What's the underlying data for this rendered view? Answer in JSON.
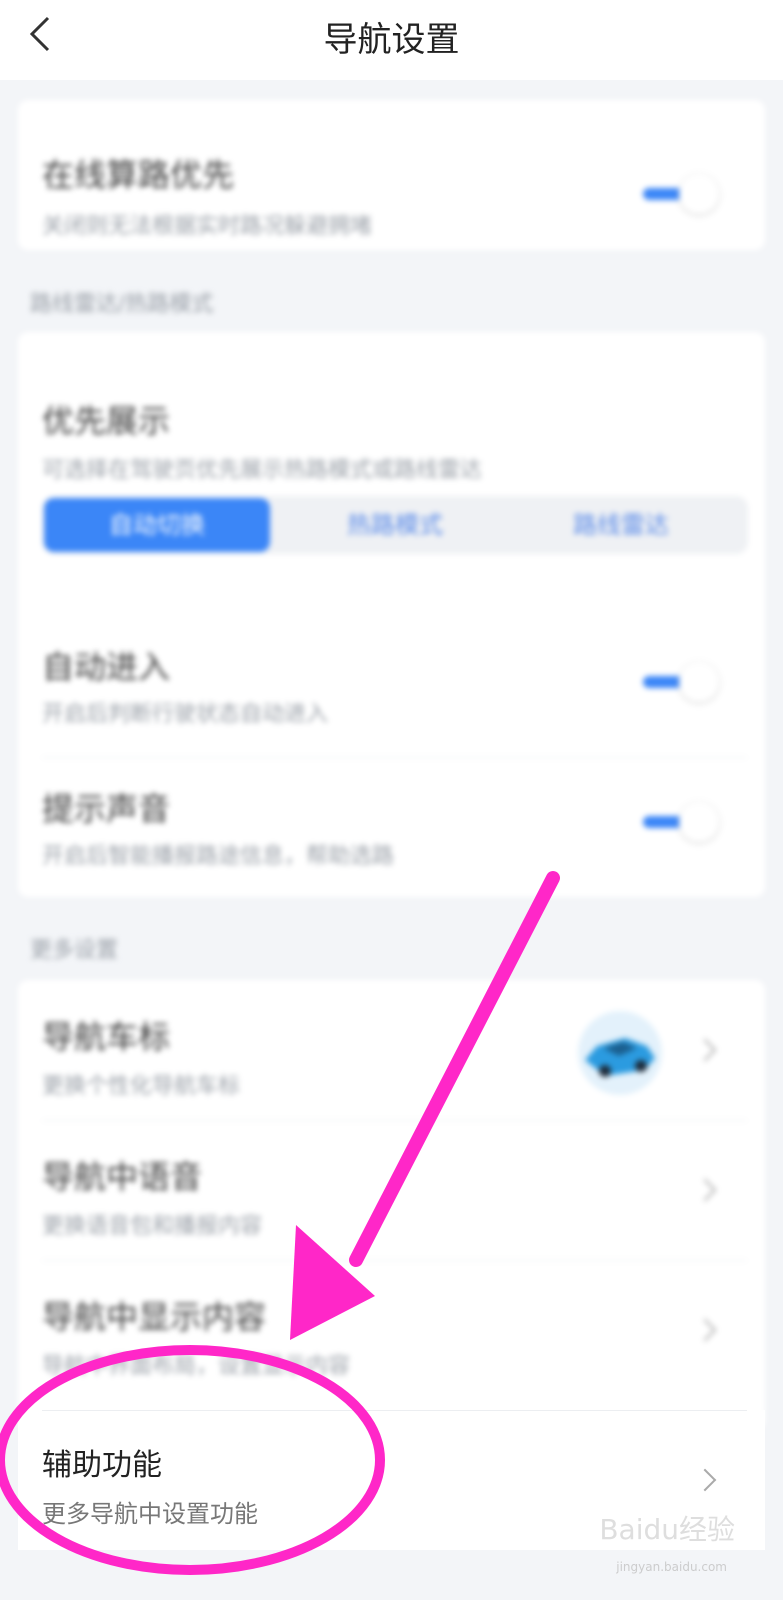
{
  "header": {
    "title": "导航设置",
    "back_icon": "chevron-left-icon"
  },
  "online_route": {
    "title": "在线算路优先",
    "subtitle": "关闭则无法根据实时路况躲避拥堵",
    "toggle_on": true
  },
  "section_display": {
    "label": "路线雷达/热路模式"
  },
  "priority_display": {
    "title": "优先展示",
    "subtitle": "可选择在驾驶页优先展示热路模式或路线雷达",
    "options": [
      "自动切换",
      "热路模式",
      "路线雷达"
    ],
    "selected": "自动切换"
  },
  "auto_enter": {
    "title": "自动进入",
    "subtitle": "开启后判断行驶状态自动进入",
    "toggle_on": true
  },
  "hint_sound": {
    "title": "提示声音",
    "subtitle": "开启后智能播报路途信息，帮助选路",
    "toggle_on": true
  },
  "section_more": {
    "label": "更多设置"
  },
  "more_items": [
    {
      "title": "导航车标",
      "subtitle": "更换个性化导航车标",
      "icon": "car-icon"
    },
    {
      "title": "导航中语音",
      "subtitle": "更换语音包和播报内容"
    },
    {
      "title": "导航中显示内容",
      "subtitle": "导航中界面布局，设置显示内容"
    }
  ],
  "assist": {
    "title": "辅助功能",
    "subtitle": "更多导航中设置功能"
  },
  "watermark": {
    "text": "Baidu经验",
    "sub": "jingyan.baidu.com"
  },
  "colors": {
    "accent": "#3b86f7",
    "annotation": "#ff27c8"
  }
}
